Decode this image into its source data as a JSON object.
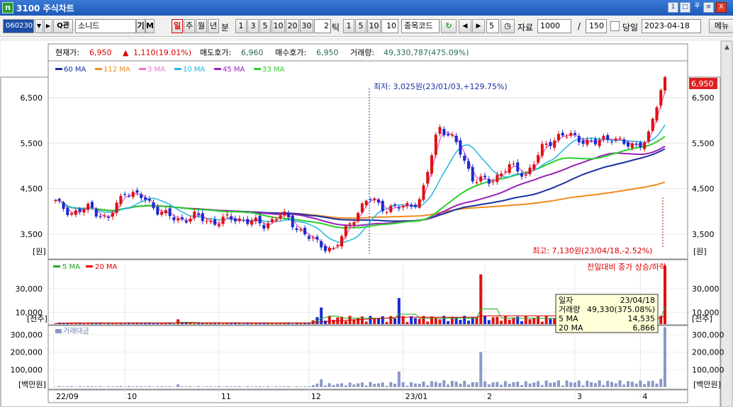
{
  "window": {
    "title": "3100 주식차트",
    "app_icon_letter": "n",
    "buttons": [
      "1",
      "□",
      "푸",
      "≡",
      "X"
    ]
  },
  "toolbar": {
    "code": "060230",
    "name": "소니드",
    "gi_label": "기",
    "m_label": "M",
    "periods": [
      "일",
      "주",
      "월",
      "년"
    ],
    "bun_label": "분",
    "minutes": [
      "1",
      "3",
      "5",
      "10",
      "20",
      "30"
    ],
    "tick_value": "2",
    "tick_label": "틱",
    "tick_options": [
      "1",
      "5",
      "10"
    ],
    "tick_custom": "10",
    "stock_code_label": "종목코드",
    "step_value": "5",
    "data_label": "자료",
    "data_count": "1000",
    "slash": "/",
    "max_count": "150",
    "today_label": "당일",
    "date": "2023-04-18",
    "menu_label": "메뉴"
  },
  "info_bar": {
    "price_label": "현재가:",
    "price": "6,950",
    "change_arrow": "▲",
    "change": "1,110(19.01%)",
    "ask_label": "매도호가:",
    "ask": "6,960",
    "bid_label": "매수호가:",
    "bid": "6,950",
    "volume_label": "거래량:",
    "volume": "49,330,787(475.09%)"
  },
  "price_panel": {
    "ma_legend": [
      {
        "name": "60 MA",
        "color": "#1a2fa0"
      },
      {
        "name": "112 MA",
        "color": "#f08a1c"
      },
      {
        "name": "3 MA",
        "color": "#f070d0"
      },
      {
        "name": "10 MA",
        "color": "#20b8e0"
      },
      {
        "name": "45 MA",
        "color": "#9a20b8"
      },
      {
        "name": "33 MA",
        "color": "#28d028"
      }
    ],
    "y_ticks": [
      "6,500",
      "5,500",
      "4,500",
      "3,500"
    ],
    "unit": "[원]",
    "low_annotation": "최저: 3,025원(23/01/03,+129.75%)",
    "high_annotation": "최고: 7,130원(23/04/18,-2.52%)",
    "last_price_tag": "6,950"
  },
  "volume_panel": {
    "legend": [
      {
        "name": "5 MA",
        "color": "#20b020"
      },
      {
        "name": "20 MA",
        "color": "#e00000"
      }
    ],
    "right_legend": "전일대비 종가 상승/하락",
    "y_ticks": [
      "30,000",
      "10,000"
    ],
    "unit": "[천주]"
  },
  "tooltip": {
    "rows": [
      {
        "label": "일자",
        "value": "23/04/18"
      },
      {
        "label": "거래량",
        "value": "49,330(375.08%)"
      },
      {
        "label": "5 MA",
        "value": "14,535"
      },
      {
        "label": "20 MA",
        "value": "6,866"
      }
    ]
  },
  "amount_panel": {
    "legend": "거래대금",
    "y_ticks": [
      "300,000",
      "200,000",
      "100,000"
    ],
    "unit": "[백만원]"
  },
  "x_axis": {
    "labels": [
      "22/09",
      "10",
      "11",
      "12",
      "23/01",
      "2",
      "3",
      "4"
    ]
  },
  "chart_data": {
    "type": "candlestick",
    "x_range": [
      "2022-09-23",
      "2023-04-18"
    ],
    "ylim": [
      3000,
      7200
    ],
    "x_month_labels": [
      "22/09",
      "10",
      "11",
      "12",
      "23/01",
      "2",
      "3",
      "4"
    ],
    "close_anchors": [
      4200,
      3950,
      4100,
      3800,
      4450,
      4300,
      4000,
      3800,
      3900,
      3750,
      3850,
      3800,
      3700,
      3950,
      3600,
      3300,
      3150,
      3800,
      4300,
      4050,
      4100,
      4250,
      5900,
      5500,
      4700,
      4650,
      5000,
      4800,
      5400,
      5700,
      5600,
      5500,
      5650,
      5400,
      5600,
      6950
    ],
    "low": {
      "value": 3025,
      "date": "23/01/03"
    },
    "high": {
      "value": 7130,
      "date": "23/04/18"
    },
    "last_close": 6950,
    "moving_averages": [
      "3 MA",
      "10 MA",
      "33 MA",
      "45 MA",
      "60 MA",
      "112 MA"
    ],
    "volume_unit": "천주",
    "volume_peaks": [
      {
        "date": "23/01/12",
        "value": 14000
      },
      {
        "date": "23/01/30",
        "value": 22000
      },
      {
        "date": "23/03/06",
        "value": 42000
      },
      {
        "date": "23/04/18",
        "value": 49330
      }
    ],
    "volume_ma_5_last": 14535,
    "volume_ma_20_last": 6866,
    "amount_unit": "백만원",
    "amount_peaks": [
      {
        "date": "23/01/30",
        "value": 130000
      },
      {
        "date": "23/03/06",
        "value": 290000
      },
      {
        "date": "23/04/18",
        "value": 320000
      }
    ]
  }
}
